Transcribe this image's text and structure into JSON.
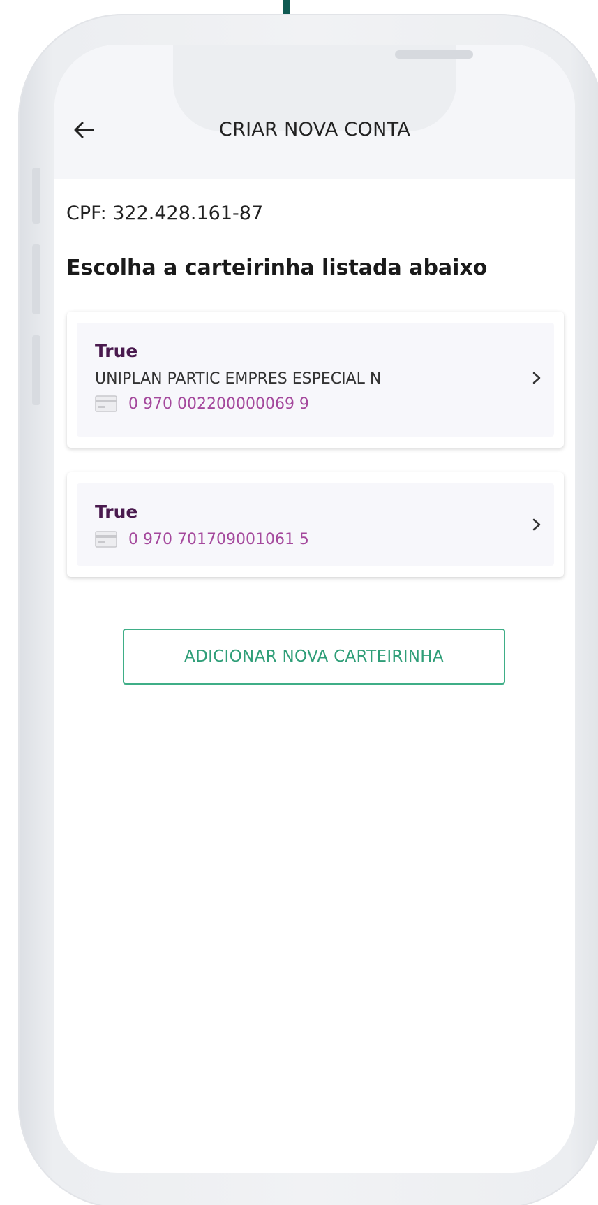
{
  "header": {
    "title": "CRIAR NOVA CONTA",
    "back_icon": "arrow-left-icon"
  },
  "cpf_text": "CPF: 322.428.161-87",
  "instruction": "Escolha a carteirinha listada abaixo",
  "cards": [
    {
      "title": "True",
      "plan": "UNIPLAN PARTIC EMPRES ESPECIAL N",
      "number": "0 970 002200000069 9",
      "icon": "card-icon",
      "chevron_icon": "chevron-right-icon"
    },
    {
      "title": "True",
      "number": "0 970 701709001061 5",
      "icon": "card-icon",
      "chevron_icon": "chevron-right-icon"
    }
  ],
  "add_button_label": "ADICIONAR NOVA CARTEIRINHA",
  "colors": {
    "accent_green": "#3fae87",
    "card_title": "#4a1a4e",
    "card_number": "#a4489c",
    "header_bg": "#f5f6f9",
    "device_frame": "#eceef1",
    "top_line": "#0f5a52"
  }
}
